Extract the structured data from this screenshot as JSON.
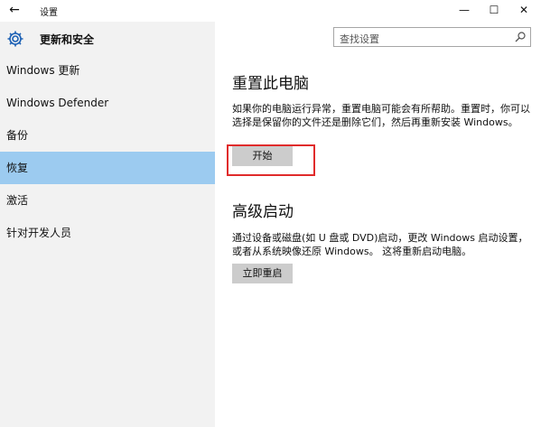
{
  "window": {
    "back_glyph": "←",
    "title": "设置",
    "minimize_glyph": "—",
    "maximize_glyph": "☐",
    "close_glyph": "✕"
  },
  "sidebar": {
    "section_title": "更新和安全",
    "items": [
      {
        "label": "Windows 更新",
        "active": false
      },
      {
        "label": "Windows Defender",
        "active": false
      },
      {
        "label": "备份",
        "active": false
      },
      {
        "label": "恢复",
        "active": true
      },
      {
        "label": "激活",
        "active": false
      },
      {
        "label": "针对开发人员",
        "active": false
      }
    ]
  },
  "search": {
    "placeholder": "查找设置"
  },
  "reset": {
    "heading": "重置此电脑",
    "description": "如果你的电脑运行异常，重置电脑可能会有所帮助。重置时，你可以选择是保留你的文件还是删除它们，然后再重新安装 Windows。",
    "button_label": "开始"
  },
  "advanced": {
    "heading": "高级启动",
    "description": "通过设备或磁盘(如 U 盘或 DVD)启动，更改 Windows 启动设置，或者从系统映像还原 Windows。 这将重新启动电脑。",
    "button_label": "立即重启"
  },
  "colors": {
    "sidebar_bg": "#f2f2f2",
    "active_item": "#9ccbf0",
    "button_bg": "#cccccc",
    "annotation_red": "#e02b2b"
  }
}
